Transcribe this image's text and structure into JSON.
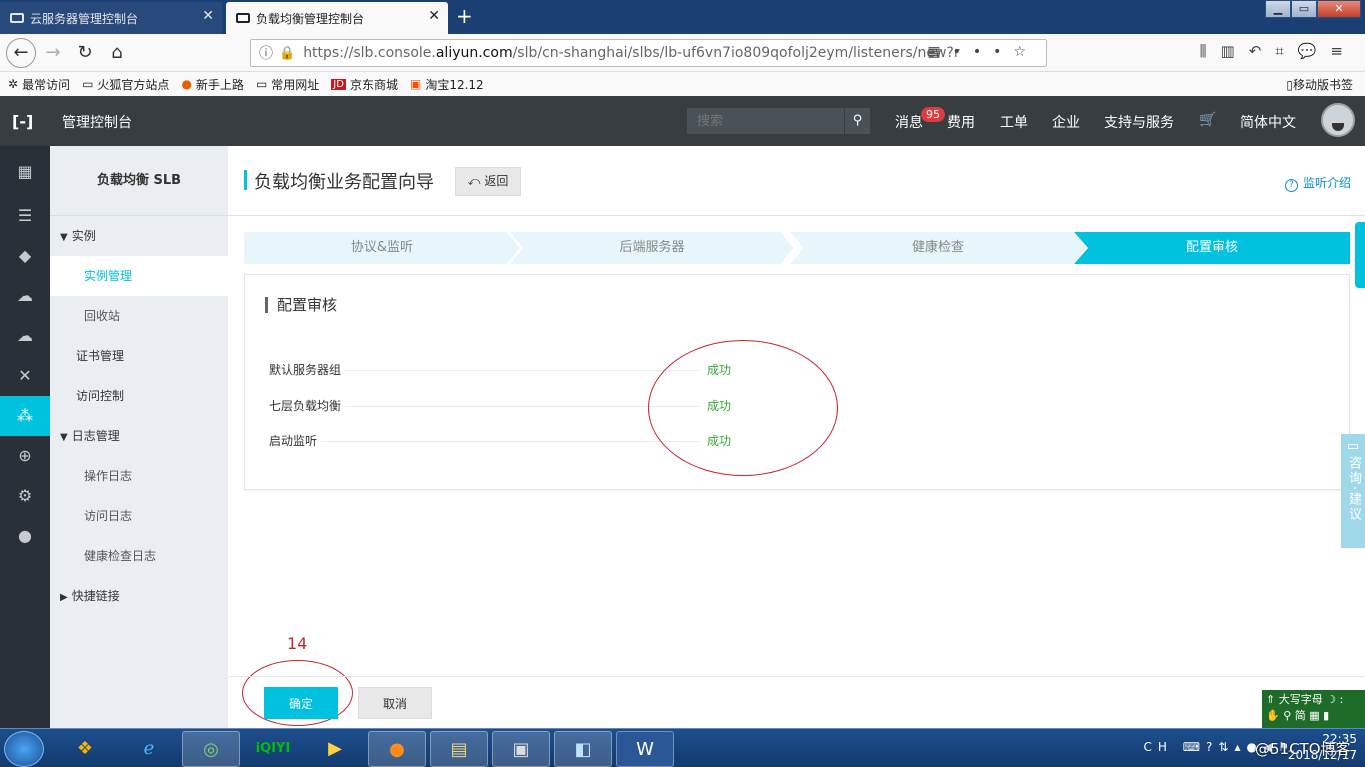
{
  "browser": {
    "tabs": [
      {
        "title": "云服务器管理控制台",
        "active": false
      },
      {
        "title": "负载均衡管理控制台",
        "active": true
      }
    ],
    "new_tab": "+",
    "url_prefix": "https://slb.console.",
    "url_domain": "aliyun.com",
    "url_suffix": "/slb/cn-shanghai/slbs/lb-uf6vn7io809qofolj2eym/listeners/new?r",
    "bookmarks": [
      "最常访问",
      "火狐官方站点",
      "新手上路",
      "常用网址",
      "京东商城",
      "淘宝12.12"
    ],
    "mobile_bookmarks": "移动版书签"
  },
  "console": {
    "title": "管理控制台",
    "search_placeholder": "搜索",
    "nav": [
      "消息",
      "费用",
      "工单",
      "企业",
      "支持与服务",
      "简体中文"
    ],
    "message_badge": "95"
  },
  "sidebar_icons": [
    "grid-icon",
    "list-icon",
    "shield-icon",
    "cloud-icon",
    "cloud-upload-icon",
    "network-icon",
    "slb-icon",
    "globe-icon",
    "settings-icon",
    "circle-icon"
  ],
  "menu": {
    "title": "负载均衡 SLB",
    "items": [
      {
        "label": "实例",
        "kind": "group"
      },
      {
        "label": "实例管理",
        "kind": "l2",
        "active": true
      },
      {
        "label": "回收站",
        "kind": "l2"
      },
      {
        "label": "证书管理",
        "kind": "l1"
      },
      {
        "label": "访问控制",
        "kind": "l1"
      },
      {
        "label": "日志管理",
        "kind": "group"
      },
      {
        "label": "操作日志",
        "kind": "l2"
      },
      {
        "label": "访问日志",
        "kind": "l2"
      },
      {
        "label": "健康检查日志",
        "kind": "l2"
      },
      {
        "label": "快捷链接",
        "kind": "group-collapsed"
      }
    ]
  },
  "page": {
    "title": "负载均衡业务配置向导",
    "back": "返回",
    "help": "监听介绍",
    "steps": [
      "协议&监听",
      "后端服务器",
      "健康检查",
      "配置审核"
    ],
    "current_step": 3,
    "card_title": "配置审核",
    "results": [
      {
        "label": "默认服务器组",
        "status": "成功"
      },
      {
        "label": "七层负载均衡",
        "status": "成功"
      },
      {
        "label": "启动监听",
        "status": "成功"
      }
    ],
    "annotation": "14",
    "ok": "确定",
    "cancel": "取消",
    "consult": "咨询·建议"
  },
  "colors": {
    "accent": "#00c1de",
    "success": "#36a83b",
    "annotation": "#c0272d",
    "header": "#373d41"
  },
  "ime": {
    "line1": "大写字母",
    "line2": "简"
  },
  "taskbar": {
    "lang": "CH",
    "time": "22:35",
    "date": "2018/12/17"
  },
  "watermark": "@51CTO博客"
}
